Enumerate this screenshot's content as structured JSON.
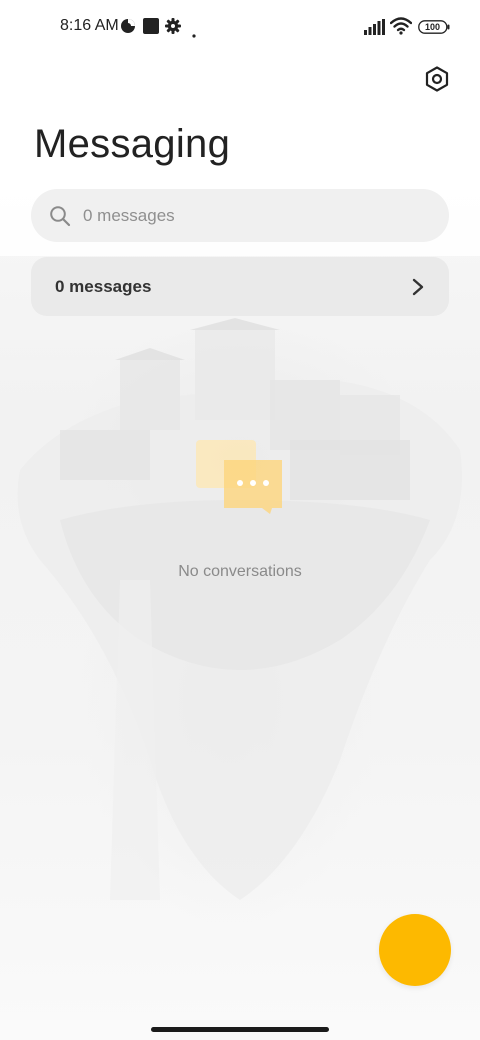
{
  "status_bar": {
    "time": "8:16 AM",
    "battery": "100",
    "icons": [
      "data-saver-icon",
      "square-notification-icon",
      "gear-notification-icon",
      "dot-icon",
      "signal-icon",
      "wifi-icon",
      "battery-icon"
    ]
  },
  "header": {
    "title": "Messaging",
    "settings_icon": "settings-hexagon-icon"
  },
  "search": {
    "placeholder": "0 messages",
    "icon": "search-icon"
  },
  "messages_row": {
    "label": "0 messages",
    "icon": "chevron-right-icon"
  },
  "empty_state": {
    "text": "No conversations",
    "icon": "chat-bubbles-icon"
  },
  "fab": {
    "color": "#fdb900"
  },
  "colors": {
    "accent": "#fdb900",
    "title": "#222222",
    "muted_text": "#8a8a8a"
  }
}
